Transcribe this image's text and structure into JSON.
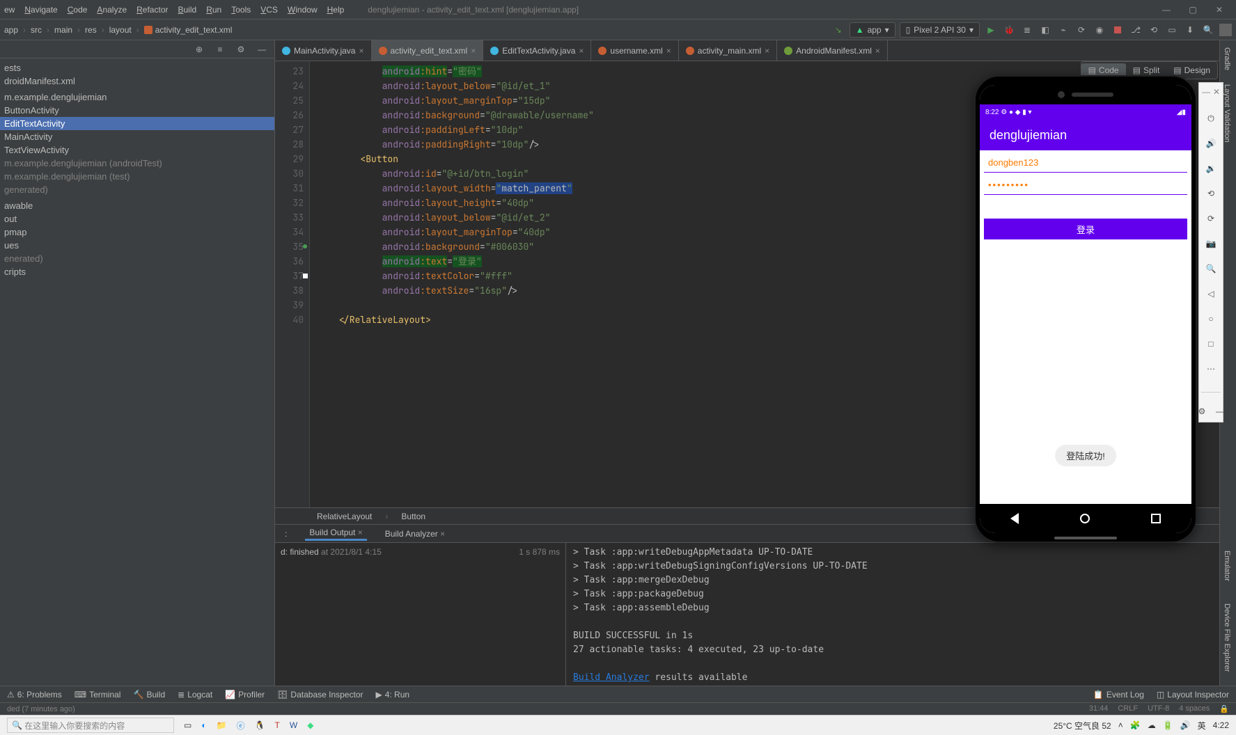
{
  "menubar": {
    "items": [
      "ew",
      "Navigate",
      "Code",
      "Analyze",
      "Refactor",
      "Build",
      "Run",
      "Tools",
      "VCS",
      "Window",
      "Help"
    ],
    "title": "denglujiemian - activity_edit_text.xml [denglujiemian.app]"
  },
  "breadcrumbs": [
    "app",
    "src",
    "main",
    "res",
    "layout",
    "activity_edit_text.xml"
  ],
  "run": {
    "app_label": "app",
    "device_label": "Pixel 2 API 30"
  },
  "tree": [
    {
      "label": "ests",
      "dim": false
    },
    {
      "label": "droidManifest.xml",
      "dim": false
    },
    {
      "label": "",
      "dim": false
    },
    {
      "label": "m.example.denglujiemian",
      "dim": false
    },
    {
      "label": "  ButtonActivity",
      "dim": false
    },
    {
      "label": "  EditTextActivity",
      "dim": false,
      "sel": true
    },
    {
      "label": "  MainActivity",
      "dim": false
    },
    {
      "label": "  TextViewActivity",
      "dim": false
    },
    {
      "label": "m.example.denglujiemian (androidTest)",
      "dim": true
    },
    {
      "label": "m.example.denglujiemian (test)",
      "dim": true
    },
    {
      "label": "generated)",
      "dim": true
    },
    {
      "label": "",
      "dim": false
    },
    {
      "label": "awable",
      "dim": false
    },
    {
      "label": "out",
      "dim": false
    },
    {
      "label": "pmap",
      "dim": false
    },
    {
      "label": "ues",
      "dim": false
    },
    {
      "label": "enerated)",
      "dim": true
    },
    {
      "label": "cripts",
      "dim": false
    }
  ],
  "tabs": [
    {
      "label": "MainActivity.java",
      "type": "java",
      "active": false,
      "close": true
    },
    {
      "label": "activity_edit_text.xml",
      "type": "xml",
      "active": true,
      "close": true
    },
    {
      "label": "EditTextActivity.java",
      "type": "java",
      "active": false,
      "close": true
    },
    {
      "label": "username.xml",
      "type": "xml",
      "active": false,
      "close": true
    },
    {
      "label": "activity_main.xml",
      "type": "xml",
      "active": false,
      "close": true
    },
    {
      "label": "AndroidManifest.xml",
      "type": "manifest",
      "active": false,
      "close": true
    }
  ],
  "lineStart": 23,
  "codeLines": [
    {
      "n": 23,
      "html": "            <span class='hl2'><span class='ns'>android</span><span class='attr'>:hint</span></span>=<span class='hl2 str'>\"密码\"</span>"
    },
    {
      "n": 24,
      "html": "            <span class='ns'>android</span><span class='attr'>:layout_below</span>=<span class='str'>\"@id/et_1\"</span>"
    },
    {
      "n": 25,
      "html": "            <span class='ns'>android</span><span class='attr'>:layout_marginTop</span>=<span class='str'>\"15dp\"</span>"
    },
    {
      "n": 26,
      "html": "            <span class='ns'>android</span><span class='attr'>:background</span>=<span class='str'>\"@drawable/username\"</span>"
    },
    {
      "n": 27,
      "html": "            <span class='ns'>android</span><span class='attr'>:paddingLeft</span>=<span class='str'>\"10dp\"</span>"
    },
    {
      "n": 28,
      "html": "            <span class='ns'>android</span><span class='attr'>:paddingRight</span>=<span class='str'>\"10dp\"</span>/&gt;"
    },
    {
      "n": 29,
      "html": "        <span class='tag'>&lt;Button</span>"
    },
    {
      "n": 30,
      "html": "            <span class='ns'>android</span><span class='attr'>:id</span>=<span class='str'>\"@+id/btn_login\"</span>"
    },
    {
      "n": 31,
      "html": "            <span class='ns'>android</span><span class='attr'>:layout_width</span>=<span class='hl str'>\"</span><span class='hl'>match_parent</span><span class='hl str'>\"</span>"
    },
    {
      "n": 32,
      "html": "            <span class='ns'>android</span><span class='attr'>:layout_height</span>=<span class='str'>\"40dp\"</span>"
    },
    {
      "n": 33,
      "html": "            <span class='ns'>android</span><span class='attr'>:layout_below</span>=<span class='str'>\"@id/et_2\"</span>"
    },
    {
      "n": 34,
      "html": "            <span class='ns'>android</span><span class='attr'>:layout_marginTop</span>=<span class='str'>\"40dp\"</span>"
    },
    {
      "n": 35,
      "html": "            <span class='ns'>android</span><span class='attr'>:background</span>=<span class='str'>\"#006030\"</span>",
      "green": true
    },
    {
      "n": 36,
      "html": "            <span class='hl2'><span class='ns'>android</span><span class='attr'>:text</span></span>=<span class='hl2 str'>\"登录\"</span>"
    },
    {
      "n": 37,
      "html": "            <span class='ns'>android</span><span class='attr'>:textColor</span>=<span class='str'>\"#fff\"</span>",
      "white": true
    },
    {
      "n": 38,
      "html": "            <span class='ns'>android</span><span class='attr'>:textSize</span>=<span class='str'>\"16sp\"</span>/&gt;"
    },
    {
      "n": 39,
      "html": ""
    },
    {
      "n": 40,
      "html": "    <span class='tag'>&lt;/RelativeLayout&gt;</span>"
    }
  ],
  "bracket": [
    "RelativeLayout",
    "Button"
  ],
  "design_modes": [
    "Code",
    "Split",
    "Design"
  ],
  "design_active": "Code",
  "build": {
    "tabs": [
      ":",
      "Build Output",
      "Build Analyzer"
    ],
    "active": "Build Output",
    "finished_label": "d: finished",
    "timestamp": "at 2021/8/1 4:15",
    "elapsed": "1 s 878 ms",
    "output": [
      "> Task :app:writeDebugAppMetadata UP-TO-DATE",
      "> Task :app:writeDebugSigningConfigVersions UP-TO-DATE",
      "> Task :app:mergeDexDebug",
      "> Task :app:packageDebug",
      "> Task :app:assembleDebug",
      "",
      "BUILD SUCCESSFUL in 1s",
      "27 actionable tasks: 4 executed, 23 up-to-date",
      ""
    ],
    "analyzer_link": "Build Analyzer",
    "analyzer_rest": " results available"
  },
  "bottom_tools": {
    "left": [
      "6: Problems",
      "Terminal",
      "Build",
      "Logcat",
      "Profiler",
      "Database Inspector",
      "4: Run"
    ],
    "right": [
      "Event Log",
      "Layout Inspector"
    ]
  },
  "status": {
    "left": "ded (7 minutes ago)",
    "right": [
      "31:44",
      "CRLF",
      "UTF-8",
      "4 spaces"
    ]
  },
  "emulator": {
    "clock": "8:22",
    "status_right": "◢▮",
    "app_title": "denglujiemian",
    "username": "dongben123",
    "password": "•••••••••",
    "button": "登录",
    "toast": "登陆成功!",
    "time_small": "4:22"
  },
  "emu_toolbar_icons": [
    "power",
    "volume-up",
    "volume-down",
    "rotate-left",
    "rotate-right",
    "camera",
    "zoom-in",
    "back",
    "home",
    "overview",
    "more"
  ],
  "taskbar": {
    "search_placeholder": "在这里输入你要搜索的内容",
    "weather": "25°C 空气良 52",
    "time": "4:22"
  }
}
